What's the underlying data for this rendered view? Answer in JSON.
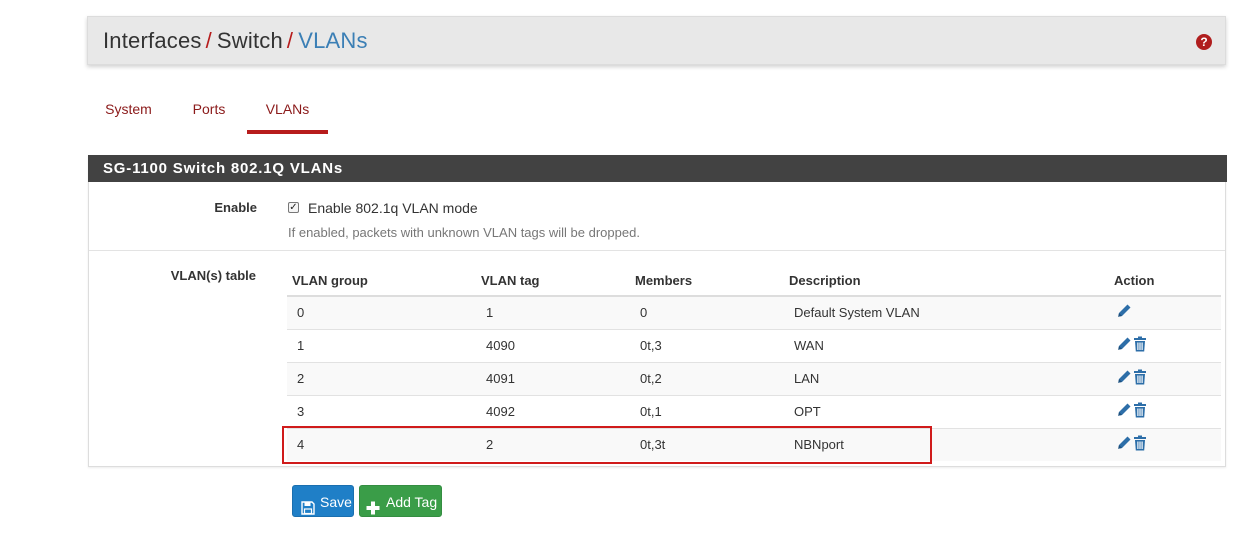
{
  "breadcrumb": {
    "items": [
      "Interfaces",
      "Switch"
    ],
    "separator": "/",
    "current": "VLANs",
    "help_icon": "question-circle-icon"
  },
  "tabs": [
    {
      "label": "System",
      "active": false
    },
    {
      "label": "Ports",
      "active": false
    },
    {
      "label": "VLANs",
      "active": true
    }
  ],
  "panel": {
    "title": "SG-1100 Switch 802.1Q VLANs",
    "enable": {
      "label": "Enable",
      "checkbox_label": "Enable 802.1q VLAN mode",
      "checked": true,
      "help_text": "If enabled, packets with unknown VLAN tags will be dropped."
    },
    "vlan_table": {
      "label": "VLAN(s) table",
      "columns": [
        "VLAN group",
        "VLAN tag",
        "Members",
        "Description",
        "Action"
      ],
      "rows": [
        {
          "group": "0",
          "tag": "1",
          "members": "0",
          "description": "Default System VLAN",
          "actions": [
            "edit"
          ]
        },
        {
          "group": "1",
          "tag": "4090",
          "members": "0t,3",
          "description": "WAN",
          "actions": [
            "edit",
            "delete"
          ]
        },
        {
          "group": "2",
          "tag": "4091",
          "members": "0t,2",
          "description": "LAN",
          "actions": [
            "edit",
            "delete"
          ]
        },
        {
          "group": "3",
          "tag": "4092",
          "members": "0t,1",
          "description": "OPT",
          "actions": [
            "edit",
            "delete"
          ]
        },
        {
          "group": "4",
          "tag": "2",
          "members": "0t,3t",
          "description": "NBNport",
          "actions": [
            "edit",
            "delete"
          ]
        }
      ]
    }
  },
  "buttons": {
    "save": {
      "label": "Save",
      "icon": "save-icon"
    },
    "add_tag": {
      "label": "Add Tag",
      "icon": "plus-icon"
    }
  },
  "colors": {
    "accent_red": "#b71c1c",
    "link_blue": "#3b7fb5",
    "panel_heading": "#424242",
    "save_button": "#1f7fc7",
    "add_button": "#3a9d48",
    "highlight_box": "#d01b1b"
  }
}
